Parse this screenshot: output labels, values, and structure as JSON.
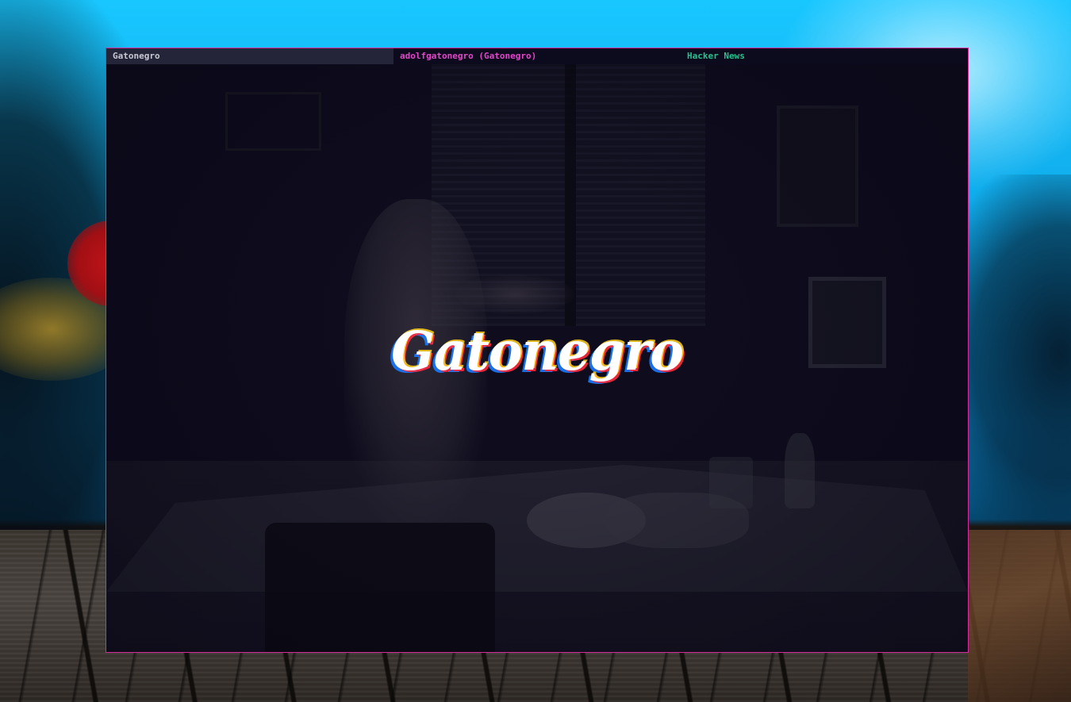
{
  "tabs": [
    {
      "label": "Gatonegro",
      "active": true
    },
    {
      "label": "adolfgatonegro (Gatonegro)",
      "color": "#e346c9"
    },
    {
      "label": "Hacker News",
      "color": "#23c48e"
    }
  ],
  "logo": {
    "text": "Gatonegro"
  },
  "colors": {
    "window_border": "#d6299b",
    "window_background": "#0e0c1d",
    "active_tab_background": "#25253a",
    "sky": "#19c7ff"
  }
}
